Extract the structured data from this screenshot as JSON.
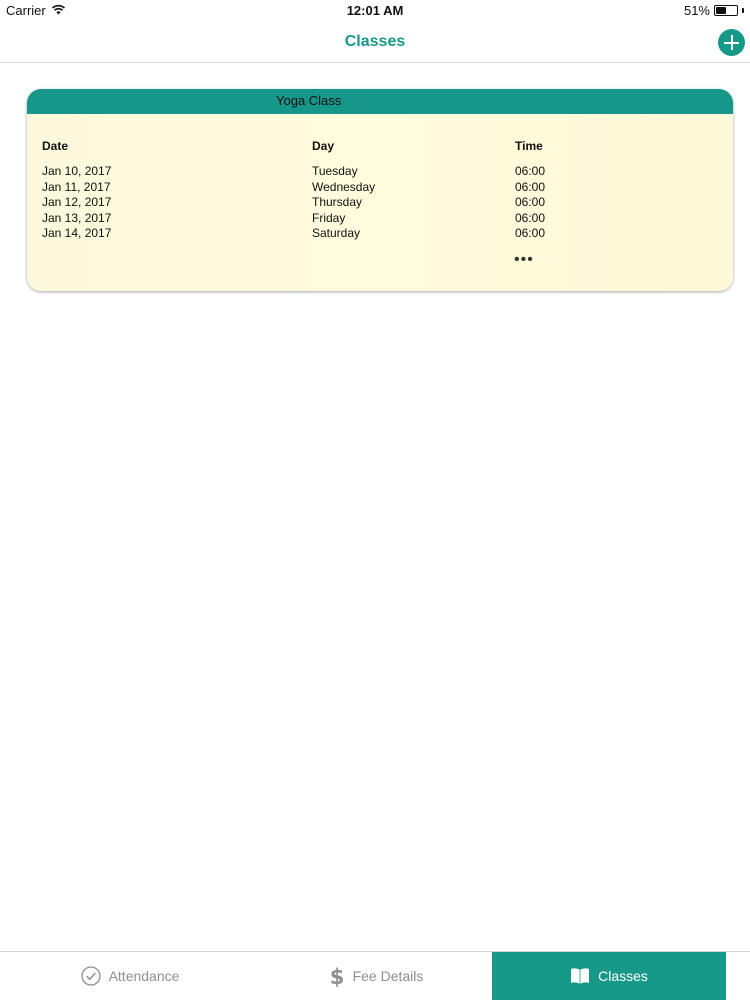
{
  "status_bar": {
    "carrier": "Carrier",
    "time": "12:01 AM",
    "battery_percent": "51%",
    "battery_level": 0.51,
    "icons": [
      "wifi-icon",
      "battery-icon"
    ]
  },
  "nav": {
    "title": "Classes",
    "add_icon": "plus-circle-icon"
  },
  "card": {
    "title": "Yoga Class",
    "columns": [
      "Date",
      "Day",
      "Time"
    ],
    "rows": [
      [
        "Jan 10, 2017",
        "Tuesday",
        "06:00"
      ],
      [
        "Jan 11, 2017",
        "Wednesday",
        "06:00"
      ],
      [
        "Jan 12, 2017",
        "Thursday",
        "06:00"
      ],
      [
        "Jan 13, 2017",
        "Friday",
        "06:00"
      ],
      [
        "Jan 14, 2017",
        "Saturday",
        "06:00"
      ]
    ],
    "more_indicator": "•••"
  },
  "tabs": [
    {
      "label": "Attendance",
      "icon": "check-circle-icon",
      "selected": false
    },
    {
      "label": "Fee Details",
      "icon": "dollar-icon",
      "selected": false
    },
    {
      "label": "Classes",
      "icon": "book-icon",
      "selected": true
    }
  ],
  "colors": {
    "accent": "#17998a",
    "card_header": "#17968a",
    "card_background": "#fffbdc",
    "tab_inactive": "#8e8e93"
  }
}
